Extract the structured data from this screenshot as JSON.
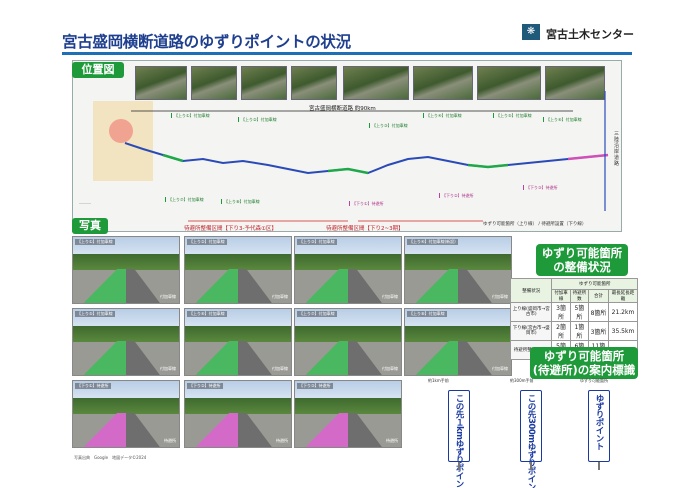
{
  "header": {
    "title": "宮古盛岡横断道路のゆずりポイントの状況",
    "org": "宮古土木センター"
  },
  "labels": {
    "location_map": "位置図",
    "photos": "写真"
  },
  "map": {
    "total_length": "宮古盛岡横断道路 約90km",
    "sanriku": "三陸沿岸道路",
    "section_1": "待避所整備区間【下り3-予代森①区】",
    "section_2": "待避所整備区間【下り2~3期】",
    "legend": "ゆずり可能箇所（上り線） / 待避所設置（下り線）"
  },
  "photos": [
    {
      "caption": "【上り①】付加車線",
      "tag": "付加車線",
      "lane": "green"
    },
    {
      "caption": "【上り②】付加車線",
      "tag": "付加車線",
      "lane": "green"
    },
    {
      "caption": "【上り③】付加車線",
      "tag": "付加車線",
      "lane": "green"
    },
    {
      "caption": "【上り④】付加車線(新設)",
      "tag": "付加車線",
      "lane": "green"
    },
    {
      "caption": "【上り⑤】付加車線",
      "tag": "付加車線",
      "lane": "green"
    },
    {
      "caption": "【上り⑥】付加車線",
      "tag": "付加車線",
      "lane": "green"
    },
    {
      "caption": "【上り⑦】付加車線",
      "tag": "付加車線",
      "lane": "green"
    },
    {
      "caption": "【上り⑧】付加車線",
      "tag": "付加車線",
      "lane": "green"
    },
    {
      "caption": "【下り①】待避所",
      "tag": "待避所",
      "lane": "pink"
    },
    {
      "caption": "【下り②】待避所",
      "tag": "待避所",
      "lane": "pink"
    },
    {
      "caption": "【下り③】待避所",
      "tag": "待避所",
      "lane": "pink"
    }
  ],
  "credit": "写真出典　Google　地図データ©2024",
  "status": {
    "title_line1": "ゆずり可能箇所",
    "title_line2": "の整備状況",
    "head_col1": "整備状況",
    "head_group": "ゆずり可能箇所",
    "head_cols": [
      "付加車線",
      "待避所数",
      "合計",
      "最長延長距離"
    ],
    "rows": [
      {
        "label": "上り線(盛岡市→宮古市)",
        "values": [
          "3箇所",
          "5箇所",
          "8箇所",
          "21.2km"
        ]
      },
      {
        "label": "下り線(宮古市→盛岡市)",
        "values": [
          "2箇所",
          "1箇所",
          "3箇所",
          "35.5km"
        ]
      },
      {
        "label": "待避所整備(新設)",
        "values": [
          "5箇所",
          "6箇所",
          "11箇所",
          "-"
        ]
      }
    ]
  },
  "guide": {
    "title_line1": "ゆずり可能箇所",
    "title_line2": "(待避所)の案内標識",
    "sign_captions": [
      "約1km手前",
      "約300m手前",
      "ゆずり可能箇所"
    ],
    "signs": [
      "この先１kmゆずりポイント",
      "この先300mゆずりポイント",
      "ゆずりポイント"
    ]
  }
}
